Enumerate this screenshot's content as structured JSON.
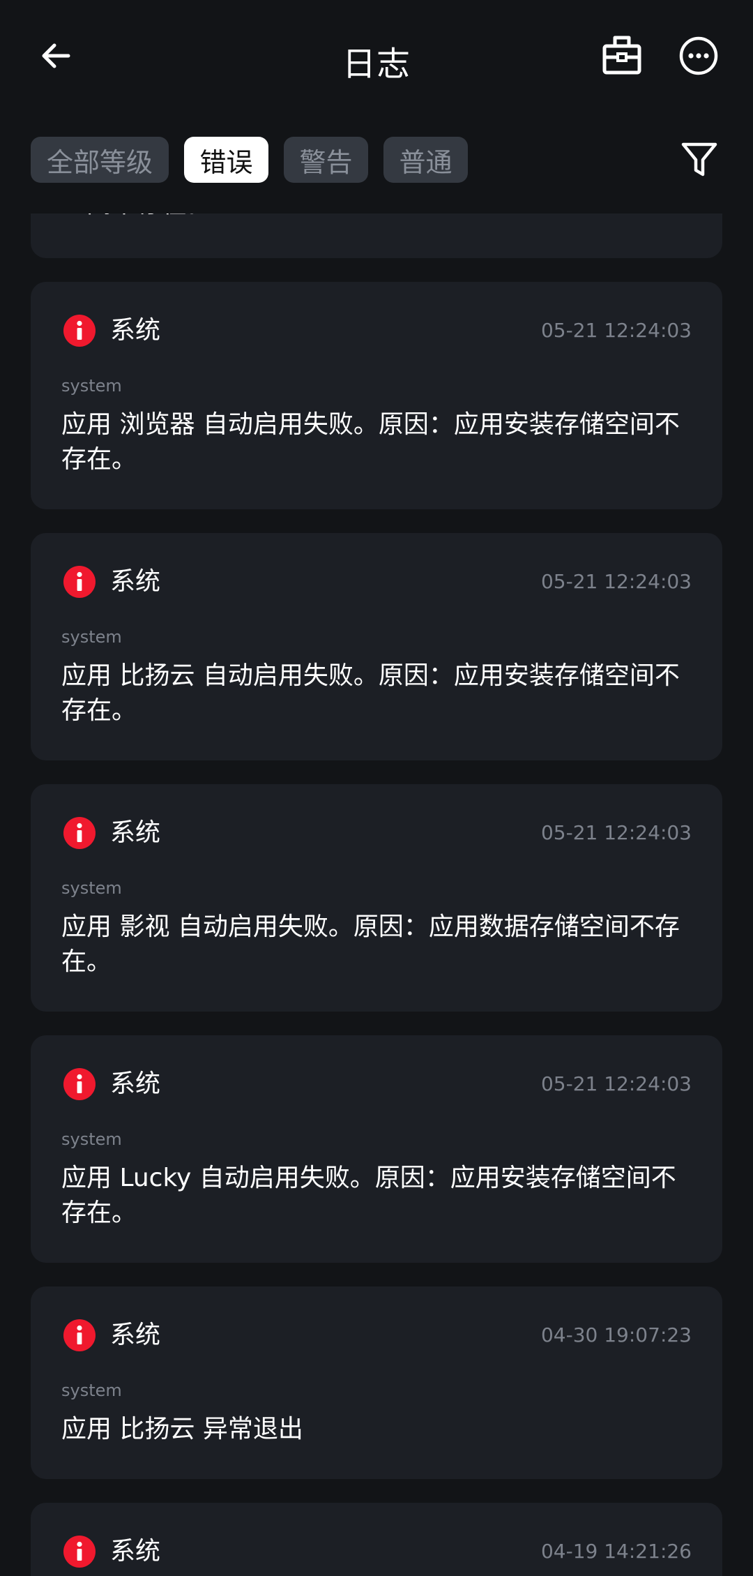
{
  "header": {
    "title": "日志"
  },
  "filters": {
    "all": "全部等级",
    "error": "错误",
    "warning": "警告",
    "normal": "普通"
  },
  "partial_card": {
    "message_tail": "空间不存在。"
  },
  "entries": [
    {
      "source": "系统",
      "time": "05-21 12:24:03",
      "tag": "system",
      "message": "应用 浏览器 自动启用失败。原因：应用安装存储空间不存在。"
    },
    {
      "source": "系统",
      "time": "05-21 12:24:03",
      "tag": "system",
      "message": "应用 比扬云 自动启用失败。原因：应用安装存储空间不存在。"
    },
    {
      "source": "系统",
      "time": "05-21 12:24:03",
      "tag": "system",
      "message": "应用 影视 自动启用失败。原因：应用数据存储空间不存在。"
    },
    {
      "source": "系统",
      "time": "05-21 12:24:03",
      "tag": "system",
      "message": "应用 Lucky 自动启用失败。原因：应用安装存储空间不存在。"
    },
    {
      "source": "系统",
      "time": "04-30 19:07:23",
      "tag": "system",
      "message": "应用 比扬云 异常退出"
    },
    {
      "source": "系统",
      "time": "04-19 14:21:26",
      "tag": "system",
      "message": ""
    }
  ],
  "icons": {
    "back": "arrow-left-icon",
    "store": "store-icon",
    "more": "more-horizontal-icon",
    "filter": "funnel-icon",
    "error": "error-info-icon"
  },
  "colors": {
    "background": "#121417",
    "card": "#1c1f25",
    "error": "#f0192e",
    "chip_inactive": "#343941",
    "chip_active": "#ffffff",
    "muted_text": "#7d828c"
  }
}
